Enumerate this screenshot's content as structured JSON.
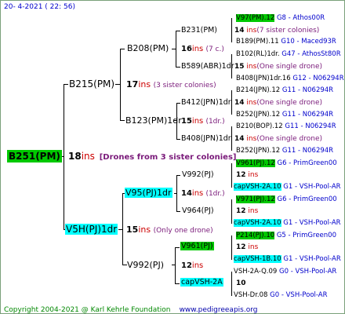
{
  "header": {
    "date": "20-  4-2021 ( 22: 56)"
  },
  "footer": {
    "copyright": "Copyright 2004-2021 @ Karl Kehrle Foundation",
    "url": "www.pedigreeapis.org"
  },
  "root": {
    "name": "B251(PM)",
    "count": "18",
    "ins": "ins",
    "note": "[Drones from 3 sister colonies]"
  },
  "sire": {
    "name": "B215(PM)",
    "count": "17",
    "ins": "ins",
    "note": "(3 sister colonies)"
  },
  "dam": {
    "name": "V5H(PJ)1dr",
    "count": "15",
    "ins": "ins",
    "note": "(Only one drone)"
  },
  "ss": {
    "name": "B208(PM)",
    "count": "16",
    "ins": "ins",
    "note": "(7 c.)"
  },
  "sd": {
    "name": "B123(PM)1dr",
    "count": "15",
    "ins": "ins",
    "note": "(1dr.)"
  },
  "ds": {
    "name": "V95(PJ)1dr",
    "count": "14",
    "ins": "ins",
    "note": "(1dr.)"
  },
  "dd": {
    "name": "V992(PJ)",
    "count": "12",
    "ins": "ins"
  },
  "sss": {
    "name": "B231(PM)",
    "count": "14",
    "ins": "ins",
    "note": "(7 sister colonies)"
  },
  "ssd": {
    "name": "B589(ABR)1dr",
    "count": "15",
    "ins": "ins",
    "note": "(One single drone)"
  },
  "sds": {
    "name": "B412(JPN)1dr",
    "count": "14",
    "ins": "ins",
    "note": "(One single drone)"
  },
  "sdd": {
    "name": "B408(JPN)1dr",
    "count": "14",
    "ins": "ins",
    "note": "(One single drone)"
  },
  "dss": {
    "name": "V992(PJ)",
    "count": "12",
    "ins": "ins"
  },
  "dsd": {
    "name": "V964(PJ)",
    "count": "12",
    "ins": "ins"
  },
  "dds": {
    "name": "V961(PJ)",
    "count": "12",
    "ins": "ins"
  },
  "ddd": {
    "name": "capVSH-2A",
    "count": "10"
  },
  "g4": [
    {
      "name": "V97(PM).12",
      "src": "G8 - Athos00R"
    },
    {
      "name": "B189(PM).11",
      "src": "G10 - Maced93R"
    },
    {
      "name": "B102(RL)1dr.",
      "src": "G47 - AthosSt80R"
    },
    {
      "name": "B408(JPN)1dr.16",
      "src": "G12 - N06294R"
    },
    {
      "name": "B214(JPN).12",
      "src": "G11 - N06294R"
    },
    {
      "name": "B252(JPN).12",
      "src": "G11 - N06294R"
    },
    {
      "name": "B210(BOP).12",
      "src": "G11 - N06294R"
    },
    {
      "name": "B252(JPN).12",
      "src": "G11 - N06294R"
    },
    {
      "name": "V961(PJ).12",
      "src": "G6 - PrimGreen00"
    },
    {
      "name": "capVSH-2A.10",
      "src": "G1 - VSH-Pool-AR"
    },
    {
      "name": "V971(PJ).12",
      "src": "G6 - PrimGreen00"
    },
    {
      "name": "capVSH-2A.10",
      "src": "G1 - VSH-Pool-AR"
    },
    {
      "name": "P214(PJ).10",
      "src": "G5 - PrimGreen00"
    },
    {
      "name": "capVSH-1B.10",
      "src": "G1 - VSH-Pool-AR"
    },
    {
      "name": "VSH-2A-Q.09",
      "src": "G0 - VSH-Pool-AR"
    },
    {
      "name": "VSH-Dr.08",
      "src": "G0 - VSH-Pool-AR"
    }
  ]
}
